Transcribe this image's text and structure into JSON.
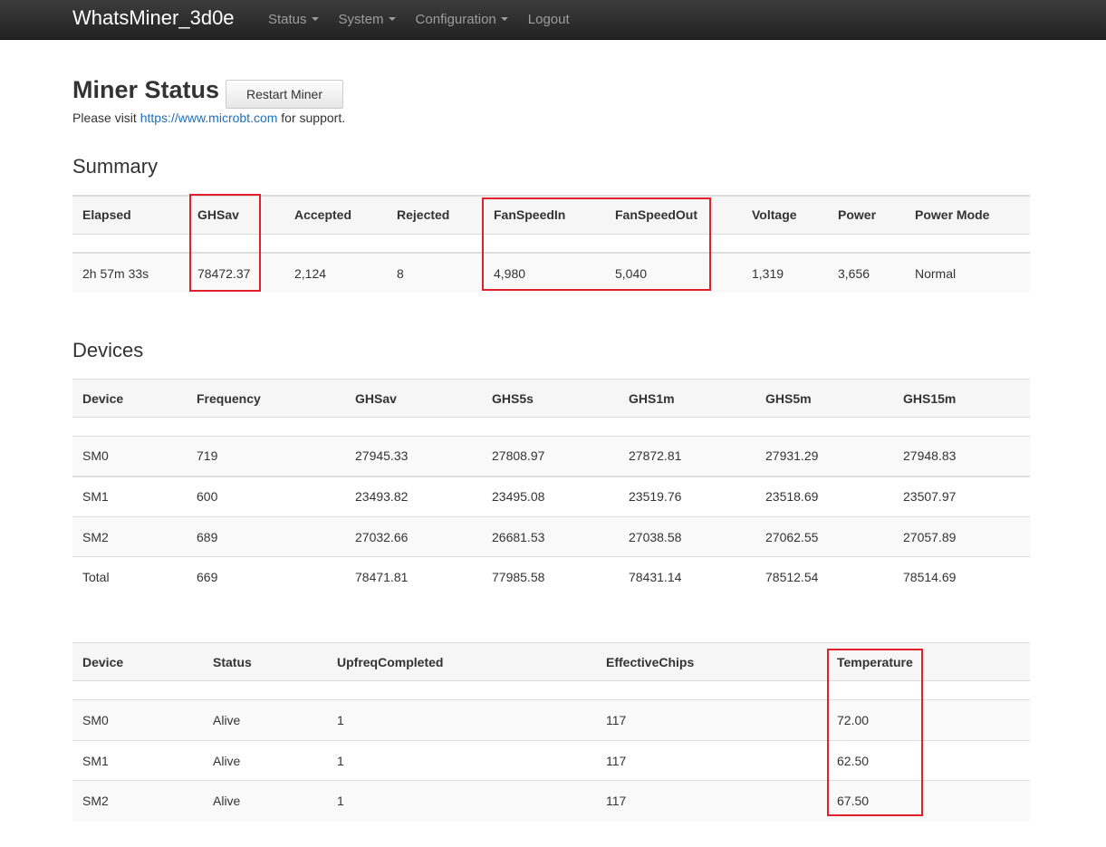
{
  "navbar": {
    "brand": "WhatsMiner_3d0e",
    "menu": [
      {
        "label": "Status",
        "dropdown": true
      },
      {
        "label": "System",
        "dropdown": true
      },
      {
        "label": "Configuration",
        "dropdown": true
      },
      {
        "label": "Logout",
        "dropdown": false
      }
    ]
  },
  "header": {
    "title": "Miner Status",
    "restart_label": "Restart Miner",
    "support_prefix": "Please visit ",
    "support_link": "https://www.microbt.com",
    "support_suffix": " for support."
  },
  "summary": {
    "title": "Summary",
    "columns": [
      "Elapsed",
      "GHSav",
      "Accepted",
      "Rejected",
      "FanSpeedIn",
      "FanSpeedOut",
      "Voltage",
      "Power",
      "Power Mode"
    ],
    "row": [
      "2h 57m 33s",
      "78472.37",
      "2,124",
      "8",
      "4,980",
      "5,040",
      "1,319",
      "3,656",
      "Normal"
    ]
  },
  "devices": {
    "title": "Devices",
    "columns": [
      "Device",
      "Frequency",
      "GHSav",
      "GHS5s",
      "GHS1m",
      "GHS5m",
      "GHS15m"
    ],
    "rows": [
      [
        "SM0",
        "719",
        "27945.33",
        "27808.97",
        "27872.81",
        "27931.29",
        "27948.83"
      ],
      [
        "SM1",
        "600",
        "23493.82",
        "23495.08",
        "23519.76",
        "23518.69",
        "23507.97"
      ],
      [
        "SM2",
        "689",
        "27032.66",
        "26681.53",
        "27038.58",
        "27062.55",
        "27057.89"
      ],
      [
        "Total",
        "669",
        "78471.81",
        "77985.58",
        "78431.14",
        "78512.54",
        "78514.69"
      ]
    ]
  },
  "device_status": {
    "columns": [
      "Device",
      "Status",
      "UpfreqCompleted",
      "EffectiveChips",
      "Temperature"
    ],
    "rows": [
      [
        "SM0",
        "Alive",
        "1",
        "117",
        "72.00"
      ],
      [
        "SM1",
        "Alive",
        "1",
        "117",
        "62.50"
      ],
      [
        "SM2",
        "Alive",
        "1",
        "117",
        "67.50"
      ]
    ]
  },
  "colors": {
    "navbar_bg": "#222222",
    "link": "#1f6fbf",
    "highlight": "#e0202a"
  }
}
